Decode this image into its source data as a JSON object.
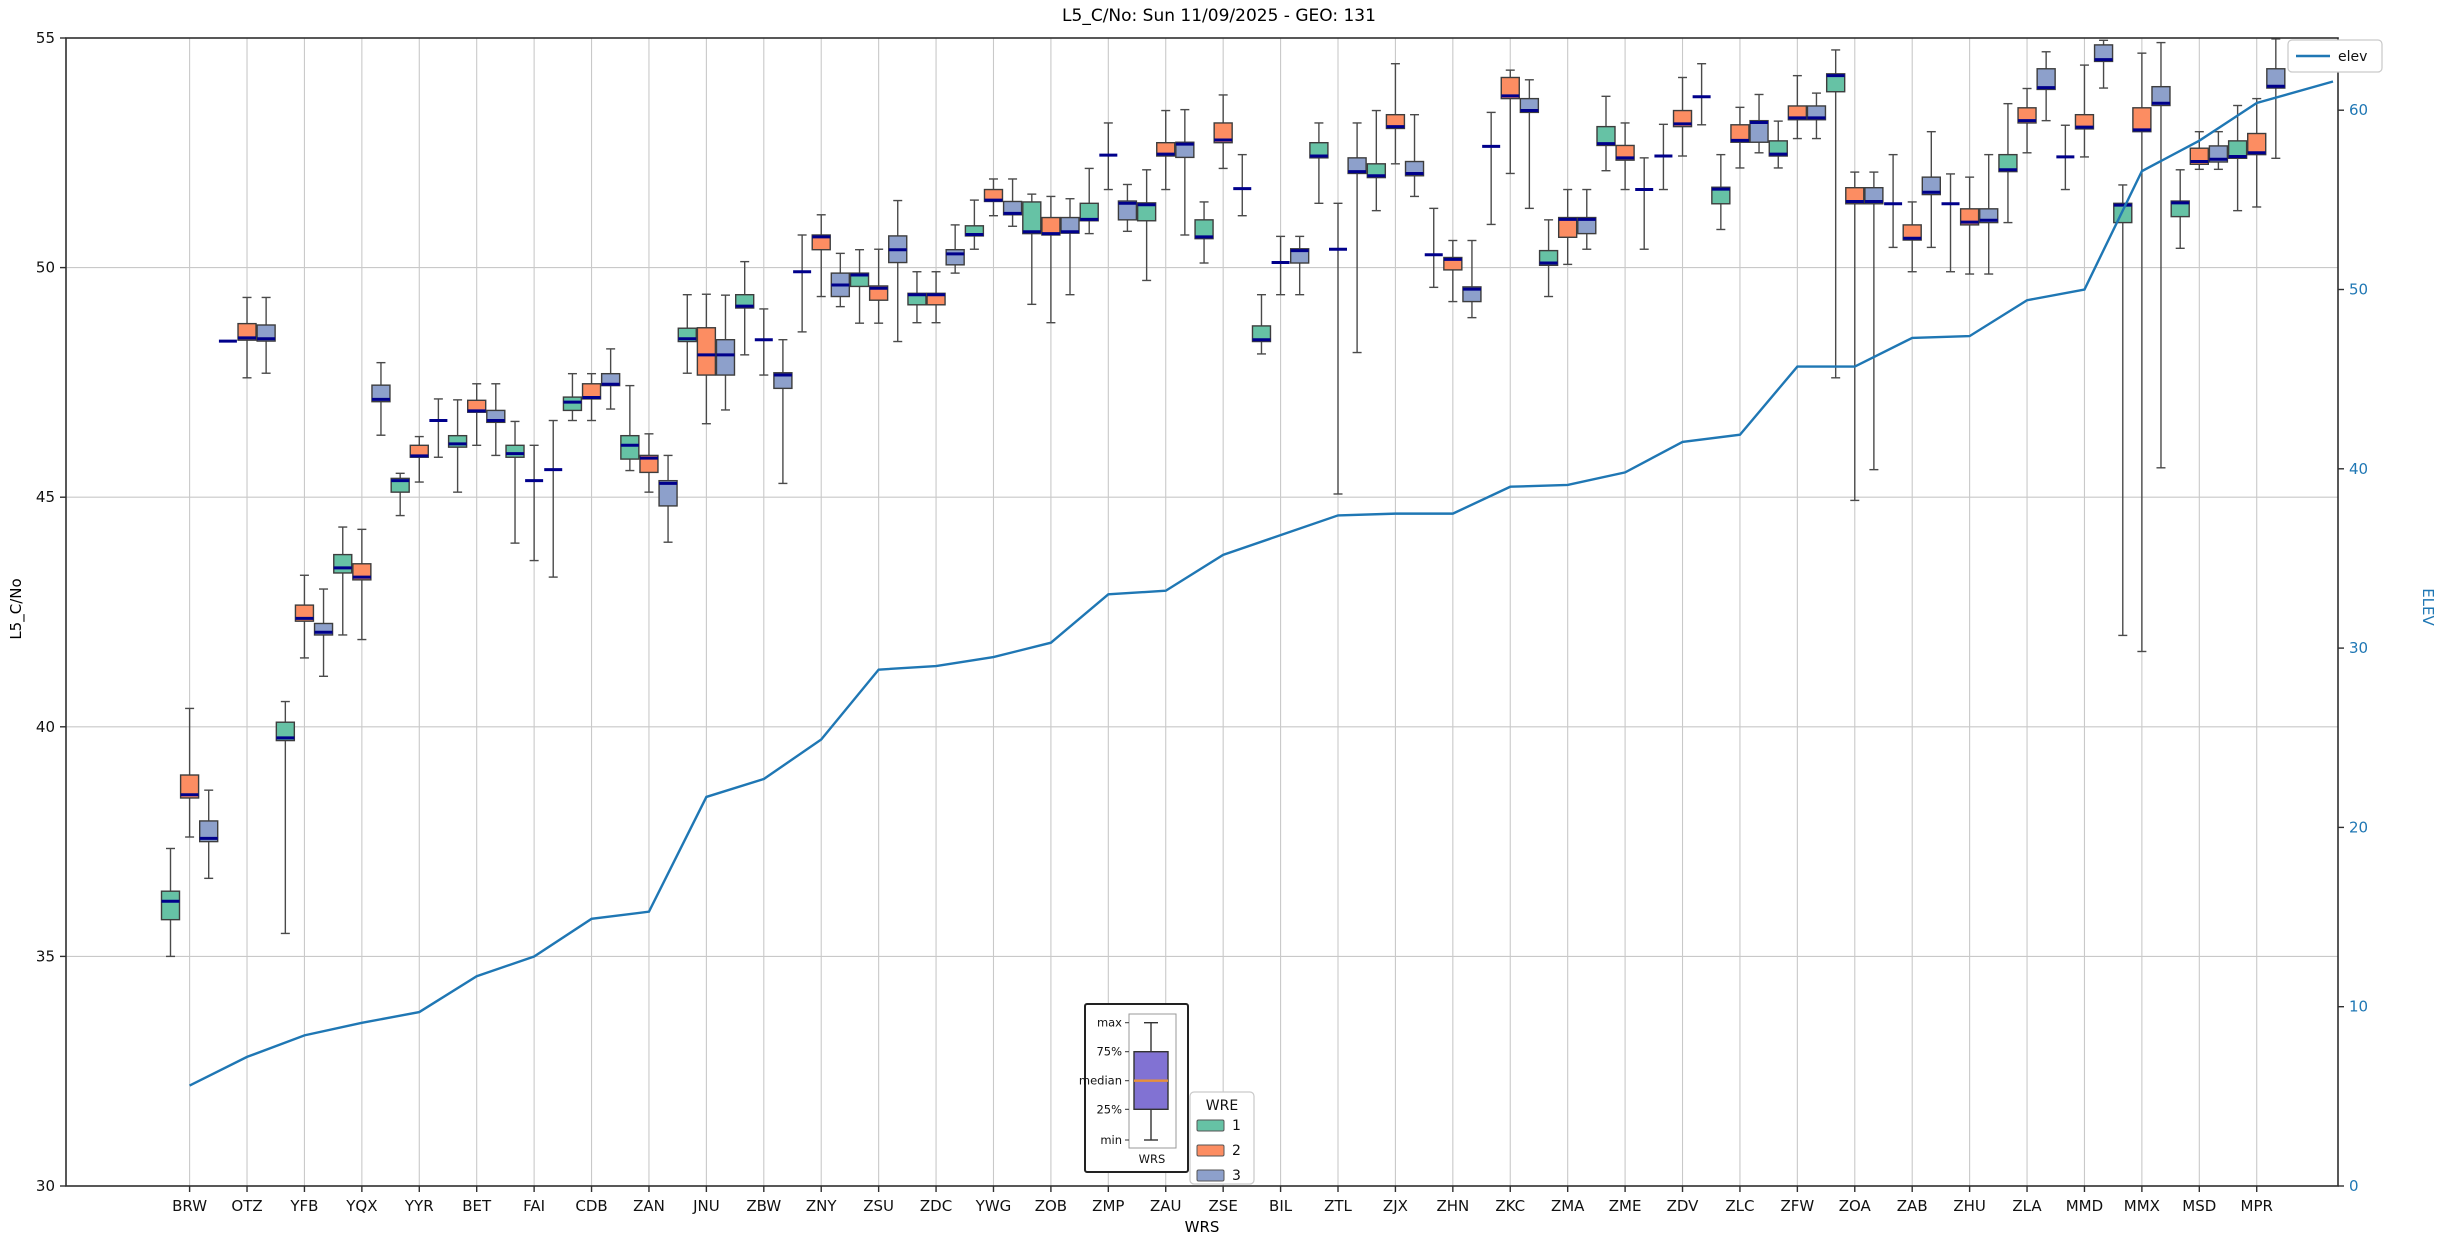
{
  "title": "L5_C/No: Sun 11/09/2025 - GEO: 131",
  "axes": {
    "left_label": "L5_C/No",
    "right_label": "ELEV",
    "x_label": "WRS",
    "left_ticks": [
      30,
      35,
      40,
      45,
      50,
      55
    ],
    "right_ticks": [
      0,
      10,
      20,
      30,
      40,
      50,
      60
    ],
    "left_range": [
      30,
      55
    ],
    "right_range": [
      0,
      64
    ],
    "grid": true
  },
  "legend_elev": {
    "label": "elev"
  },
  "legend_wre": {
    "title": "WRE",
    "entries": [
      {
        "label": "1",
        "color": "#66c2a5"
      },
      {
        "label": "2",
        "color": "#fc8d62"
      },
      {
        "label": "3",
        "color": "#8da0cb"
      }
    ]
  },
  "inset": {
    "tick_labels": [
      "max",
      "75%",
      "median",
      "25%",
      "min"
    ],
    "xlabel": "WRS",
    "box_color": "#8172d3",
    "median_color": "#e8903a"
  },
  "colors": {
    "series1": "#66c2a5",
    "series2": "#fc8d62",
    "series3": "#8da0cb",
    "box_edge": "#3d3d3d",
    "median": "#00008b",
    "whisker": "#4a4a4a",
    "elev_line": "#1f77b4",
    "grid": "#c9c9c9",
    "spine": "#2f2f2f",
    "right_axis_text": "#1f77b4"
  },
  "chart_data": {
    "type": "boxplot+line",
    "title": "L5_C/No: Sun 11/09/2025 - GEO: 131",
    "xlabel": "WRS",
    "ylabel": "L5_C/No",
    "y2label": "ELEV",
    "ylim": [
      30,
      55
    ],
    "y2lim": [
      0,
      64
    ],
    "series_names": [
      "1",
      "2",
      "3"
    ],
    "box_stats_order": [
      "min",
      "q1",
      "median",
      "q3",
      "max"
    ],
    "elev_line_end": 61.6,
    "categories": [
      {
        "code": "BRW",
        "elev": 5.6,
        "wre1": [
          35.0,
          35.8,
          36.2,
          36.42,
          37.35
        ],
        "wre2": [
          37.6,
          38.45,
          38.52,
          38.95,
          40.4
        ],
        "wre3": [
          36.7,
          37.5,
          37.57,
          37.95,
          38.62
        ]
      },
      {
        "code": "OTZ",
        "elev": 7.2,
        "wre1": [
          48.4,
          48.4,
          48.4,
          48.4,
          48.4
        ],
        "wre2": [
          47.6,
          48.42,
          48.47,
          48.78,
          49.35
        ],
        "wre3": [
          47.7,
          48.4,
          48.45,
          48.75,
          49.35
        ]
      },
      {
        "code": "YFB",
        "elev": 8.4,
        "wre1": [
          35.5,
          39.7,
          39.76,
          40.1,
          40.55
        ],
        "wre2": [
          41.5,
          42.3,
          42.36,
          42.65,
          43.3
        ],
        "wre3": [
          41.1,
          42.0,
          42.06,
          42.25,
          43.0
        ]
      },
      {
        "code": "YQX",
        "elev": 9.1,
        "wre1": [
          42.0,
          43.35,
          43.46,
          43.75,
          44.35
        ],
        "wre2": [
          41.9,
          43.2,
          43.26,
          43.55,
          44.3
        ],
        "wre3": [
          46.35,
          47.08,
          47.13,
          47.44,
          47.93
        ]
      },
      {
        "code": "YYR",
        "elev": 9.7,
        "wre1": [
          44.6,
          45.11,
          45.36,
          45.41,
          45.52
        ],
        "wre2": [
          45.33,
          45.87,
          45.9,
          46.13,
          46.32
        ],
        "wre3": [
          45.87,
          46.62,
          46.67,
          46.72,
          47.14
        ]
      },
      {
        "code": "BET",
        "elev": 11.7,
        "wre1": [
          45.11,
          46.09,
          46.16,
          46.34,
          47.12
        ],
        "wre2": [
          46.13,
          46.85,
          46.88,
          47.11,
          47.47
        ],
        "wre3": [
          45.91,
          46.63,
          46.67,
          46.89,
          47.47
        ]
      },
      {
        "code": "FAI",
        "elev": 12.8,
        "wre1": [
          44.0,
          45.87,
          45.95,
          46.13,
          46.65
        ],
        "wre2": [
          43.62,
          45.31,
          45.36,
          45.41,
          46.13
        ],
        "wre3": [
          43.26,
          45.55,
          45.6,
          45.65,
          46.67
        ]
      },
      {
        "code": "CDB",
        "elev": 14.9,
        "wre1": [
          46.67,
          46.89,
          47.07,
          47.18,
          47.69
        ],
        "wre2": [
          46.67,
          47.14,
          47.17,
          47.47,
          47.69
        ],
        "wre3": [
          46.92,
          47.43,
          47.46,
          47.69,
          48.23
        ]
      },
      {
        "code": "ZAN",
        "elev": 15.3,
        "wre1": [
          45.58,
          45.83,
          46.13,
          46.34,
          47.43
        ],
        "wre2": [
          45.11,
          45.54,
          45.85,
          45.91,
          46.38
        ],
        "wre3": [
          44.02,
          44.81,
          45.3,
          45.36,
          45.91
        ]
      },
      {
        "code": "JNU",
        "elev": 21.7,
        "wre1": [
          47.7,
          48.39,
          48.45,
          48.68,
          49.41
        ],
        "wre2": [
          46.6,
          47.66,
          48.1,
          48.69,
          49.42
        ],
        "wre3": [
          46.9,
          47.66,
          48.1,
          48.43,
          49.4
        ]
      },
      {
        "code": "ZBW",
        "elev": 22.7,
        "wre1": [
          48.1,
          49.12,
          49.16,
          49.41,
          50.13
        ],
        "wre2": [
          47.66,
          48.4,
          48.43,
          48.47,
          49.1
        ],
        "wre3": [
          45.3,
          47.37,
          47.66,
          47.71,
          48.43
        ]
      },
      {
        "code": "ZNY",
        "elev": 24.9,
        "wre1": [
          48.6,
          49.86,
          49.91,
          49.96,
          50.71
        ],
        "wre2": [
          49.37,
          50.39,
          50.67,
          50.71,
          51.15
        ],
        "wre3": [
          49.15,
          49.37,
          49.62,
          49.88,
          50.31
        ]
      },
      {
        "code": "ZSU",
        "elev": 28.8,
        "wre1": [
          48.79,
          49.59,
          49.84,
          49.88,
          50.39
        ],
        "wre2": [
          48.79,
          49.29,
          49.55,
          49.6,
          50.4
        ],
        "wre3": [
          48.39,
          50.11,
          50.39,
          50.69,
          51.46
        ]
      },
      {
        "code": "ZDC",
        "elev": 29.0,
        "wre1": [
          48.8,
          49.19,
          49.41,
          49.44,
          49.91
        ],
        "wre2": [
          48.8,
          49.19,
          49.41,
          49.44,
          49.91
        ],
        "wre3": [
          49.88,
          50.06,
          50.3,
          50.39,
          50.93
        ]
      },
      {
        "code": "YWG",
        "elev": 29.5,
        "wre1": [
          50.4,
          50.69,
          50.72,
          50.91,
          51.47
        ],
        "wre2": [
          51.13,
          51.44,
          51.47,
          51.7,
          51.93
        ],
        "wre3": [
          50.9,
          51.15,
          51.18,
          51.44,
          51.93
        ]
      },
      {
        "code": "ZOB",
        "elev": 30.3,
        "wre1": [
          49.2,
          50.74,
          50.78,
          51.43,
          51.6
        ],
        "wre2": [
          48.8,
          50.71,
          50.74,
          51.09,
          51.55
        ],
        "wre3": [
          49.41,
          50.75,
          50.78,
          51.09,
          51.5
        ]
      },
      {
        "code": "ZMP",
        "elev": 33.0,
        "wre1": [
          50.74,
          51.02,
          51.05,
          51.4,
          52.16
        ],
        "wre2": [
          51.7,
          52.41,
          52.45,
          52.49,
          53.15
        ],
        "wre3": [
          50.79,
          51.04,
          51.4,
          51.45,
          51.81
        ]
      },
      {
        "code": "ZAU",
        "elev": 33.2,
        "wre1": [
          49.72,
          51.02,
          51.37,
          51.41,
          52.13
        ],
        "wre2": [
          51.7,
          52.43,
          52.47,
          52.72,
          53.42
        ],
        "wre3": [
          50.71,
          52.4,
          52.69,
          52.73,
          53.44
        ]
      },
      {
        "code": "ZSE",
        "elev": 35.2,
        "wre1": [
          50.1,
          50.63,
          50.67,
          51.04,
          51.43
        ],
        "wre2": [
          52.16,
          52.72,
          52.78,
          53.15,
          53.76
        ],
        "wre3": [
          51.13,
          51.68,
          51.72,
          51.76,
          52.46
        ]
      },
      {
        "code": "BIL",
        "elev": 36.3,
        "wre1": [
          48.12,
          48.39,
          48.43,
          48.73,
          49.41
        ],
        "wre2": [
          49.41,
          50.06,
          50.11,
          50.16,
          50.68
        ],
        "wre3": [
          49.41,
          50.1,
          50.37,
          50.41,
          50.68
        ]
      },
      {
        "code": "ZTL",
        "elev": 37.4,
        "wre1": [
          51.4,
          52.39,
          52.43,
          52.72,
          53.15
        ],
        "wre2": [
          45.07,
          50.36,
          50.4,
          50.44,
          51.4
        ],
        "wre3": [
          48.15,
          52.05,
          52.09,
          52.39,
          53.15
        ]
      },
      {
        "code": "ZJX",
        "elev": 37.5,
        "wre1": [
          51.24,
          51.96,
          52.0,
          52.26,
          53.42
        ],
        "wre2": [
          52.26,
          53.03,
          53.07,
          53.33,
          54.44
        ],
        "wre3": [
          51.55,
          52.0,
          52.05,
          52.31,
          53.33
        ]
      },
      {
        "code": "ZHN",
        "elev": 37.5,
        "wre1": [
          49.57,
          50.23,
          50.28,
          50.33,
          51.29
        ],
        "wre2": [
          49.26,
          49.95,
          50.18,
          50.22,
          50.59
        ],
        "wre3": [
          48.91,
          49.26,
          49.53,
          49.58,
          50.59
        ]
      },
      {
        "code": "ZKC",
        "elev": 39.0,
        "wre1": [
          50.94,
          52.59,
          52.64,
          52.69,
          53.38
        ],
        "wre2": [
          52.05,
          53.68,
          53.74,
          54.14,
          54.3
        ],
        "wre3": [
          51.29,
          53.38,
          53.42,
          53.68,
          54.09
        ]
      },
      {
        "code": "ZMA",
        "elev": 39.1,
        "wre1": [
          49.37,
          50.05,
          50.1,
          50.37,
          51.04
        ],
        "wre2": [
          50.07,
          50.66,
          51.05,
          51.09,
          51.7
        ],
        "wre3": [
          50.4,
          50.74,
          51.05,
          51.09,
          51.7
        ]
      },
      {
        "code": "ZME",
        "elev": 39.8,
        "wre1": [
          52.11,
          52.66,
          52.7,
          53.07,
          53.73
        ],
        "wre2": [
          51.7,
          52.34,
          52.39,
          52.66,
          53.15
        ],
        "wre3": [
          50.4,
          51.65,
          51.7,
          51.75,
          52.39
        ]
      },
      {
        "code": "ZDV",
        "elev": 41.5,
        "wre1": [
          51.7,
          52.38,
          52.43,
          52.48,
          53.12
        ],
        "wre2": [
          52.43,
          53.07,
          53.13,
          53.42,
          54.14
        ],
        "wre3": [
          53.11,
          53.67,
          53.72,
          53.77,
          54.44
        ]
      },
      {
        "code": "ZLC",
        "elev": 41.9,
        "wre1": [
          50.83,
          51.39,
          51.71,
          51.75,
          52.46
        ],
        "wre2": [
          52.17,
          52.73,
          52.77,
          53.11,
          53.49
        ],
        "wre3": [
          52.5,
          52.73,
          53.16,
          53.2,
          53.77
        ]
      },
      {
        "code": "ZFW",
        "elev": 45.7,
        "wre1": [
          52.17,
          52.43,
          52.47,
          52.76,
          53.19
        ],
        "wre2": [
          52.81,
          53.22,
          53.26,
          53.52,
          54.18
        ],
        "wre3": [
          52.81,
          53.22,
          53.26,
          53.52,
          53.8
        ]
      },
      {
        "code": "ZOA",
        "elev": 45.7,
        "wre1": [
          47.6,
          53.83,
          54.18,
          54.22,
          54.74
        ],
        "wre2": [
          44.93,
          51.39,
          51.44,
          51.74,
          52.08
        ],
        "wre3": [
          45.6,
          51.39,
          51.44,
          51.74,
          52.08
        ]
      },
      {
        "code": "ZAB",
        "elev": 47.3,
        "wre1": [
          50.44,
          51.34,
          51.39,
          51.44,
          52.46
        ],
        "wre2": [
          49.91,
          50.6,
          50.64,
          50.93,
          51.43
        ],
        "wre3": [
          50.44,
          51.59,
          51.64,
          51.97,
          52.96
        ]
      },
      {
        "code": "ZHU",
        "elev": 47.4,
        "wre1": [
          49.91,
          51.34,
          51.39,
          51.44,
          52.04
        ],
        "wre2": [
          49.86,
          50.93,
          50.99,
          51.28,
          51.97
        ],
        "wre3": [
          49.86,
          50.98,
          51.03,
          51.28,
          52.46
        ]
      },
      {
        "code": "ZLA",
        "elev": 49.4,
        "wre1": [
          50.98,
          52.09,
          52.13,
          52.46,
          53.57
        ],
        "wre2": [
          52.5,
          53.15,
          53.2,
          53.48,
          53.9
        ],
        "wre3": [
          53.2,
          53.88,
          53.92,
          54.33,
          54.7
        ]
      },
      {
        "code": "MMD",
        "elev": 50.0,
        "wre1": [
          51.7,
          52.36,
          52.41,
          52.46,
          53.1
        ],
        "wre2": [
          52.41,
          53.02,
          53.06,
          53.33,
          54.41
        ],
        "wre3": [
          53.91,
          54.49,
          54.53,
          54.85,
          54.95
        ]
      },
      {
        "code": "MMX",
        "elev": 56.6,
        "wre1": [
          41.99,
          50.98,
          51.36,
          51.4,
          51.8
        ],
        "wre2": [
          41.64,
          52.96,
          53.0,
          53.48,
          54.67
        ],
        "wre3": [
          45.64,
          53.53,
          53.58,
          53.94,
          54.9
        ]
      },
      {
        "code": "MSD",
        "elev": 58.3,
        "wre1": [
          50.42,
          51.11,
          51.41,
          51.45,
          52.13
        ],
        "wre2": [
          52.14,
          52.25,
          52.31,
          52.6,
          52.96
        ],
        "wre3": [
          52.14,
          52.3,
          52.36,
          52.65,
          52.96
        ]
      },
      {
        "code": "MPR",
        "elev": 60.4,
        "wre1": [
          51.24,
          52.38,
          52.42,
          52.76,
          53.53
        ],
        "wre2": [
          51.32,
          52.46,
          52.5,
          52.92,
          53.68
        ],
        "wre3": [
          52.38,
          53.91,
          53.95,
          54.33,
          54.98
        ]
      }
    ]
  }
}
